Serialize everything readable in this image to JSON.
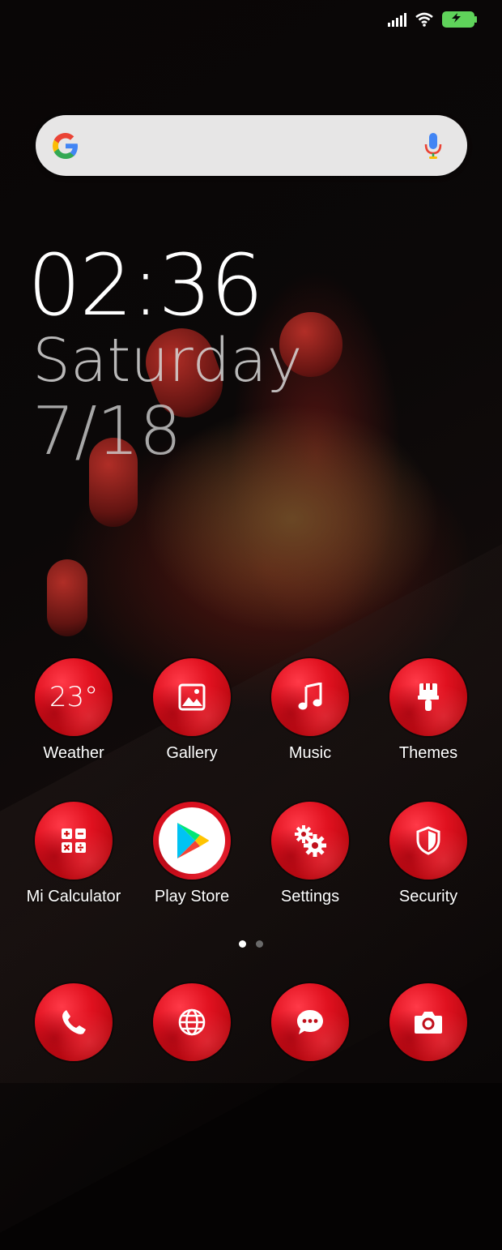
{
  "status_bar": {
    "signal_icon": "signal-bars-icon",
    "wifi_icon": "wifi-icon",
    "battery_icon": "battery-charging-icon",
    "battery_color": "#5fd35a"
  },
  "search": {
    "logo_icon": "google-g-icon",
    "mic_icon": "mic-icon"
  },
  "clock": {
    "time": "02:36",
    "day": "Saturday",
    "date": "7/18"
  },
  "apps_row1": [
    {
      "label": "Weather",
      "icon": "weather-icon",
      "value": "23°"
    },
    {
      "label": "Gallery",
      "icon": "gallery-icon"
    },
    {
      "label": "Music",
      "icon": "music-note-icon"
    },
    {
      "label": "Themes",
      "icon": "paintbrush-icon"
    }
  ],
  "apps_row2": [
    {
      "label": "Mi Calculator",
      "icon": "calculator-icon"
    },
    {
      "label": "Play Store",
      "icon": "play-store-icon"
    },
    {
      "label": "Settings",
      "icon": "gears-icon"
    },
    {
      "label": "Security",
      "icon": "shield-icon"
    }
  ],
  "page_indicator": {
    "pages": 2,
    "current": 1
  },
  "dock": [
    {
      "icon": "phone-icon"
    },
    {
      "icon": "browser-globe-icon"
    },
    {
      "icon": "messages-icon"
    },
    {
      "icon": "camera-icon"
    }
  ],
  "colors": {
    "accent_red": "#e0111f",
    "search_bg": "#e7e6e6"
  }
}
